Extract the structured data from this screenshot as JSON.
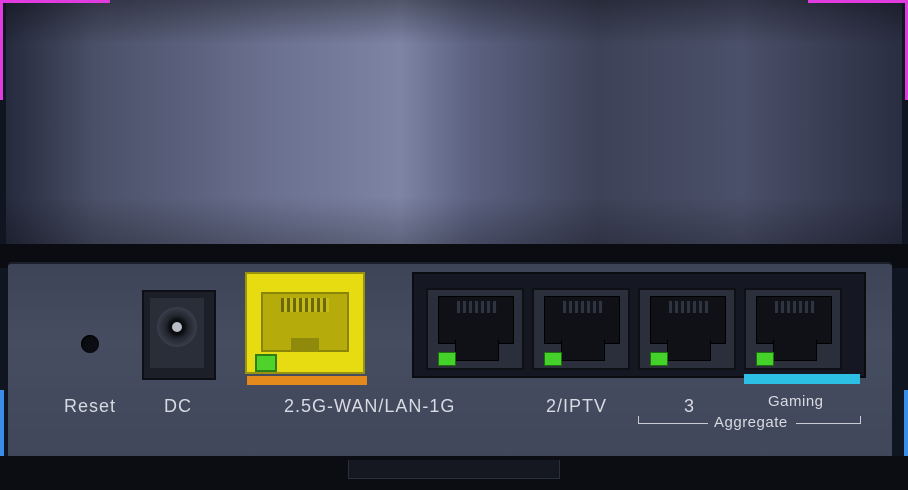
{
  "colors": {
    "glow_top": "#e03ce0",
    "glow_bottom": "#3c8de8",
    "wan_port": "#e7dc12",
    "wan_underline": "#e48a1d",
    "gaming_underline": "#2cc0e4",
    "led_green": "#43d12a"
  },
  "ports": {
    "reset": "Reset",
    "dc": "DC",
    "wan": "2.5G-WAN/LAN-1G",
    "lan2": "2/IPTV",
    "lan3": "3",
    "gaming": "Gaming",
    "aggregate": "Aggregate"
  }
}
